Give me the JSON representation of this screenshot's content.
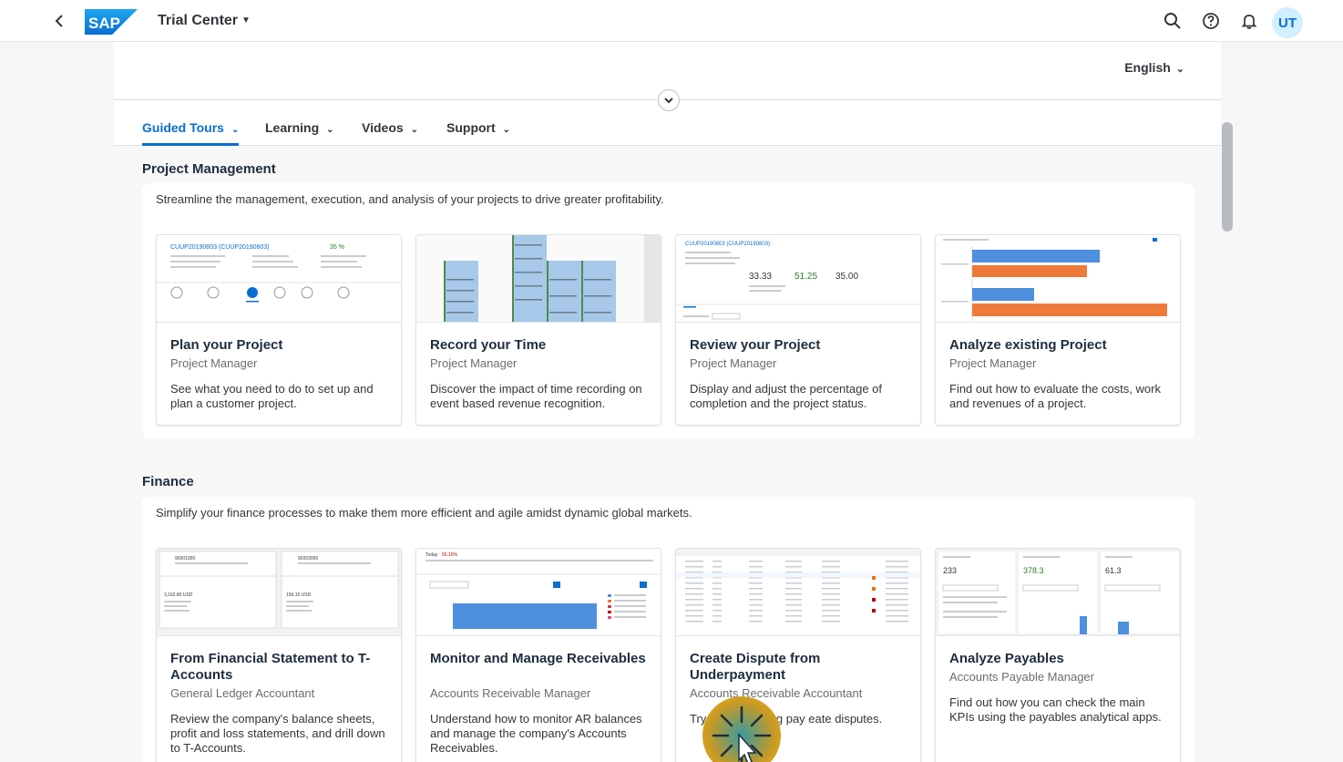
{
  "shell": {
    "back_icon": "chevron-left-icon",
    "logo_text": "SAP",
    "app_title": "Trial Center",
    "avatar_initials": "UT",
    "icons": [
      "search-icon",
      "help-icon",
      "notification-bell-icon"
    ]
  },
  "header": {
    "language": "English"
  },
  "tabs": [
    {
      "label": "Guided Tours",
      "active": true
    },
    {
      "label": "Learning",
      "active": false
    },
    {
      "label": "Videos",
      "active": false
    },
    {
      "label": "Support",
      "active": false
    }
  ],
  "sections": [
    {
      "title": "Project Management",
      "description": "Streamline the management, execution, and analysis of your projects to drive greater profitability.",
      "cards": [
        {
          "title": "Plan your Project",
          "role": "Project Manager",
          "description": "See what you need to do to set up and plan a customer project."
        },
        {
          "title": "Record your Time",
          "role": "Project Manager",
          "description": "Discover the impact of time recording on event based revenue recognition."
        },
        {
          "title": "Review your Project",
          "role": "Project Manager",
          "description": "Display and adjust the percentage of completion and the project status."
        },
        {
          "title": "Analyze existing Project",
          "role": "Project Manager",
          "description": "Find out how to evaluate the costs, work and revenues of a project."
        }
      ]
    },
    {
      "title": "Finance",
      "description": "Simplify your finance processes to make them more efficient and agile amidst dynamic global markets.",
      "cards": [
        {
          "title": "From Financial Statement to T-Accounts",
          "role": "General Ledger Accountant",
          "description": "Review the company's balance sheets, profit and loss statements, and drill down to T-Accounts."
        },
        {
          "title": "Monitor and Manage Receivables",
          "role": "Accounts Receivable Manager",
          "description": "Understand how to monitor AR balances and manage the company's Accounts Receivables."
        },
        {
          "title": "Create Dispute from Underpayment",
          "role": "Accounts Receivable Accountant",
          "description": "Try post incoming pay eate disputes."
        },
        {
          "title": "Analyze Payables",
          "role": "Accounts Payable Manager",
          "description": "Find out how you can check the main KPIs using the payables analytical apps."
        }
      ]
    }
  ],
  "thumbs": {
    "plan": {
      "project": "CUUP20190803 (CUUP20190803)",
      "percent": "35 %"
    },
    "review": {
      "project": "CUUP20190803 (CUUP20190803)",
      "v1": "33.33",
      "v2": "51.25",
      "v3": "35.00"
    },
    "payables": {
      "v1": "233",
      "v2": "378.3",
      "v3": "61.3"
    },
    "receivables": {
      "today": "Today",
      "pct": "56.16%"
    },
    "tacc": {
      "a1": "90301000",
      "a2": "90303000",
      "amt1": "3,162.80 USD",
      "amt2": "156.15 USD"
    }
  },
  "colors": {
    "accent": "#0a6ed1",
    "bar_blue": "#4e8fde",
    "bar_orange": "#ee7a3a",
    "gantt_blue": "#a7c8e8",
    "gantt_green": "#4a8c4a"
  }
}
